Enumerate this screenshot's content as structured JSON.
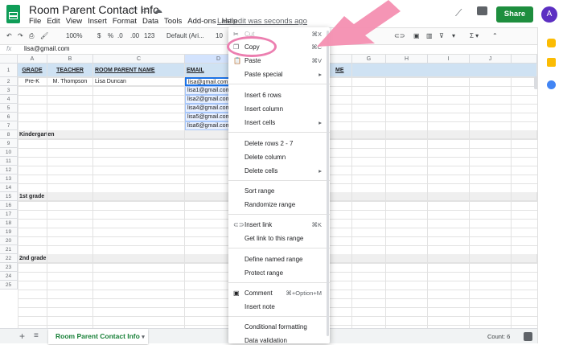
{
  "app": {
    "title": "Room Parent Contact Info",
    "menu": [
      "File",
      "Edit",
      "View",
      "Insert",
      "Format",
      "Data",
      "Tools",
      "Add-ons",
      "Help"
    ],
    "last_edit": "Last edit was seconds ago",
    "share_label": "Share",
    "avatar_letter": "A"
  },
  "toolbar": {
    "zoom": "100%",
    "currency": "$",
    "percent": "%",
    "dec1": ".0",
    "dec2": ".00",
    "numfmt": "123",
    "font": "Default (Ari...",
    "size": "10"
  },
  "formula_bar": {
    "fx": "fx",
    "value": "lisa@gmail.com"
  },
  "columns": [
    "A",
    "B",
    "C",
    "D",
    "E",
    "F",
    "G",
    "H",
    "I",
    "J"
  ],
  "row_numbers": [
    "1",
    "2",
    "3",
    "4",
    "5",
    "6",
    "7",
    "8",
    "9",
    "10",
    "11",
    "12",
    "13",
    "14",
    "15",
    "16",
    "17",
    "18",
    "19",
    "20",
    "21",
    "22",
    "23",
    "24",
    "25"
  ],
  "sheet": {
    "headers": [
      "GRADE",
      "TEACHER",
      "ROOM PARENT NAME",
      "EMAIL"
    ],
    "header_tail": "ME",
    "row2": {
      "grade": "Pre-K",
      "teacher": "M. Thompson",
      "parent": "Lisa Duncan",
      "email": "lisa@gmail.com"
    },
    "emails": [
      "lisa1@gmail.com",
      "lisa2@gmail.com",
      "lisa4@gmail.com",
      "lisa5@gmail.com",
      "lisa6@gmail.com"
    ],
    "sections": [
      "Kindergarten",
      "1st grade",
      "2nd grade"
    ]
  },
  "sheet_tab": {
    "name": "Room Parent Contact Info",
    "add": "+",
    "list": "≡",
    "count": "Count: 6"
  },
  "context_menu": {
    "cut": "Cut",
    "cut_sc": "⌘X",
    "copy": "Copy",
    "copy_sc": "⌘C",
    "paste": "Paste",
    "paste_sc": "⌘V",
    "paste_special": "Paste special",
    "insert_rows": "Insert 6 rows",
    "insert_column": "Insert column",
    "insert_cells": "Insert cells",
    "delete_rows": "Delete rows 2 - 7",
    "delete_column": "Delete column",
    "delete_cells": "Delete cells",
    "sort_range": "Sort range",
    "randomize_range": "Randomize range",
    "insert_link": "Insert link",
    "insert_link_sc": "⌘K",
    "get_link": "Get link to this range",
    "define_named_range": "Define named range",
    "protect_range": "Protect range",
    "comment": "Comment",
    "comment_sc": "⌘+Option+M",
    "insert_note": "Insert note",
    "conditional_formatting": "Conditional formatting",
    "data_validation": "Data validation"
  },
  "colors": {
    "green": "#1e8e3e",
    "header_blue": "#cfe2f3",
    "pink": "#ec7fb0"
  }
}
